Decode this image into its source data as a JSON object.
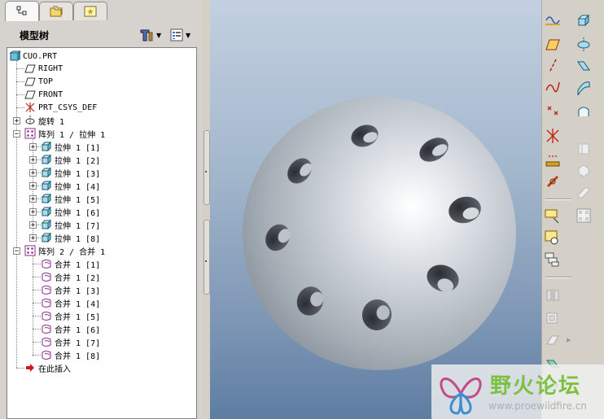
{
  "panel": {
    "title": "模型树",
    "tabs": [
      {
        "icon": "model-tree-icon"
      },
      {
        "icon": "folder-browser-icon"
      },
      {
        "icon": "favorites-icon"
      }
    ],
    "settings_icon": "tools-icon",
    "show_icon": "list-view-icon"
  },
  "tree": {
    "root": "CUO.PRT",
    "datums": [
      "RIGHT",
      "TOP",
      "FRONT"
    ],
    "csys": "PRT_CSYS_DEF",
    "revolve": "旋转 1",
    "pattern1": "阵列 1 / 拉伸 1",
    "pattern1_items": [
      "拉伸 1 [1]",
      "拉伸 1 [2]",
      "拉伸 1 [3]",
      "拉伸 1 [4]",
      "拉伸 1 [5]",
      "拉伸 1 [6]",
      "拉伸 1 [7]",
      "拉伸 1 [8]"
    ],
    "pattern2": "阵列 2 / 合并 1",
    "pattern2_items": [
      "合并 1 [1]",
      "合并 1 [2]",
      "合并 1 [3]",
      "合并 1 [4]",
      "合并 1 [5]",
      "合并 1 [6]",
      "合并 1 [7]",
      "合并 1 [8]"
    ],
    "insert_here": "在此插入"
  },
  "watermark": {
    "title": "野火论坛",
    "url": "www.proewildfire.cn"
  },
  "colors": {
    "viewport_top": "#c2d0e0",
    "viewport_bottom": "#5e7da3",
    "pattern_purple": "#8a2b8a",
    "watermark_green": "#7bc143"
  }
}
